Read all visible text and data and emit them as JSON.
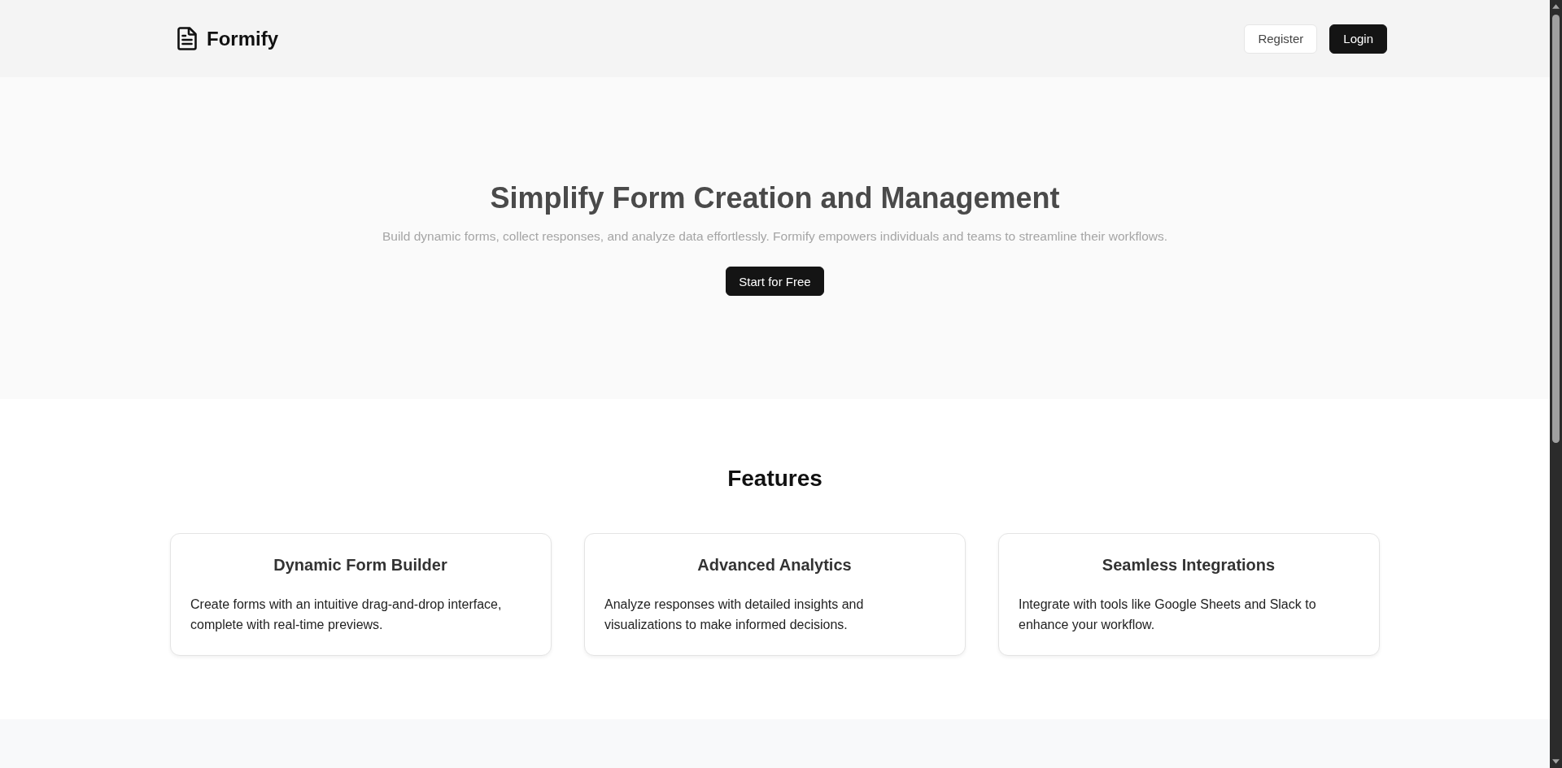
{
  "header": {
    "logo": "Formify",
    "buttons": [
      {
        "label": "Register",
        "kind": "outline"
      },
      {
        "label": "Login",
        "kind": "solid"
      }
    ]
  },
  "hero": {
    "title": "Simplify Form Creation and Management",
    "subtitle": "Build dynamic forms, collect responses, and analyze data effortlessly. Formify empowers individuals and teams to streamline their workflows.",
    "cta": "Start for Free"
  },
  "features": {
    "title": "Features",
    "cards": [
      {
        "title": "Dynamic Form Builder",
        "description": "Create forms with an intuitive drag-and-drop interface, complete with real-time previews."
      },
      {
        "title": "Advanced Analytics",
        "description": "Analyze responses with detailed insights and visualizations to make informed decisions."
      },
      {
        "title": "Seamless Integrations",
        "description": "Integrate with tools like Google Sheets and Slack to enhance your workflow."
      }
    ]
  }
}
